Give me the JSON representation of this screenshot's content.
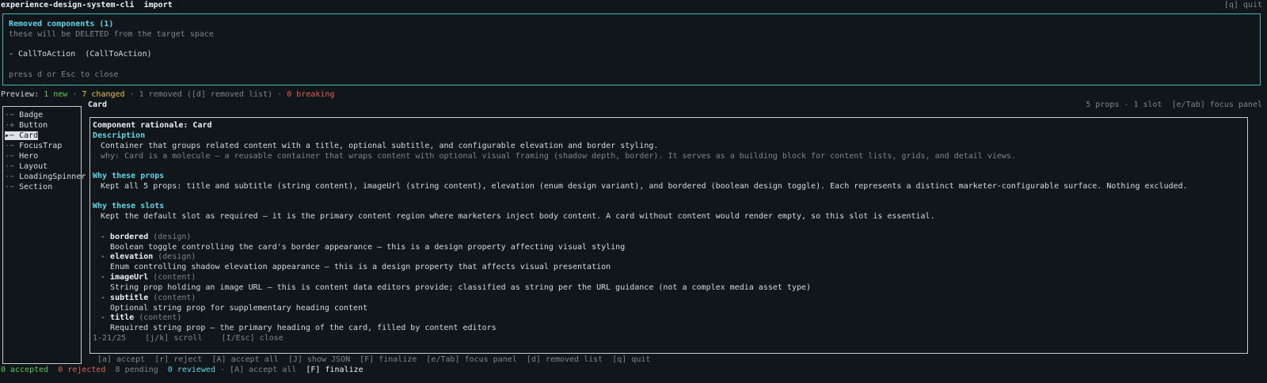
{
  "header": {
    "app": "experience-design-system-cli",
    "command": "import",
    "quit_hint": "[q] quit"
  },
  "removed_modal": {
    "title": "Removed components (1)",
    "subtitle": "these will be DELETED from the target space",
    "items": [
      "- CallToAction  (CallToAction)"
    ],
    "hint": "press d or Esc to close"
  },
  "preview": {
    "label": "Preview:",
    "new": "1 new",
    "sep1": " · ",
    "changed": "7 changed",
    "sep2": " · ",
    "removed": "1 removed ([d] removed list)",
    "sep3": " · ",
    "breaking": "0 breaking"
  },
  "sidebar": {
    "items": [
      {
        "marker": "·~",
        "label": "Badge"
      },
      {
        "marker": "·+",
        "label": "Button"
      },
      {
        "marker": "▸~",
        "label": "Card"
      },
      {
        "marker": "·~",
        "label": "FocusTrap"
      },
      {
        "marker": "·~",
        "label": "Hero"
      },
      {
        "marker": "·~",
        "label": "Layout"
      },
      {
        "marker": "·~",
        "label": "LoadingSpinner"
      },
      {
        "marker": "·~",
        "label": "Section"
      }
    ]
  },
  "panel": {
    "component_title": "Card",
    "meta": "5 props · 1 slot  [e/Tab] focus panel",
    "rationale_title": "Component rationale: Card",
    "description_heading": "Description",
    "description": "Container that groups related content with a title, optional subtitle, and configurable elevation and border styling.",
    "why": "why: Card is a molecule — a reusable container that wraps content with optional visual framing (shadow depth, border). It serves as a building block for content lists, grids, and detail views.",
    "props_heading": "Why these props",
    "props_text": "Kept all 5 props: title and subtitle (string content), imageUrl (string content), elevation (enum design variant), and bordered (boolean design toggle). Each represents a distinct marketer-configurable surface. Nothing excluded.",
    "slots_heading": "Why these slots",
    "slots_text": "Kept the default slot as required — it is the primary content region where marketers inject body content. A card without content would render empty, so this slot is essential.",
    "props": [
      {
        "name": "bordered",
        "kind": "(design)",
        "desc": "Boolean toggle controlling the card's border appearance — this is a design property affecting visual styling"
      },
      {
        "name": "elevation",
        "kind": "(design)",
        "desc": "Enum controlling shadow elevation appearance — this is a design property that affects visual presentation"
      },
      {
        "name": "imageUrl",
        "kind": "(content)",
        "desc": "String prop holding an image URL — this is content data editors provide; classified as string per the URL guidance (not a complex media asset type)"
      },
      {
        "name": "subtitle",
        "kind": "(content)",
        "desc": "Optional string prop for supplementary heading content"
      },
      {
        "name": "title",
        "kind": "(content)",
        "desc": "Required string prop — the primary heading of the card, filled by content editors"
      }
    ],
    "footer": "1-21/25    [j/k] scroll    [I/Esc] close"
  },
  "keyhints": "[a] accept  [r] reject  [A] accept all  [J] show JSON  [F] finalize  [e/Tab] focus panel  [d] removed list  [q] quit",
  "status": {
    "accepted": "0 accepted",
    "rejected": "0 rejected",
    "pending": "8 pending",
    "reviewed": "0 reviewed",
    "sep": " · ",
    "accept_all": "[A] accept all",
    "finalize": "[F] finalize"
  }
}
